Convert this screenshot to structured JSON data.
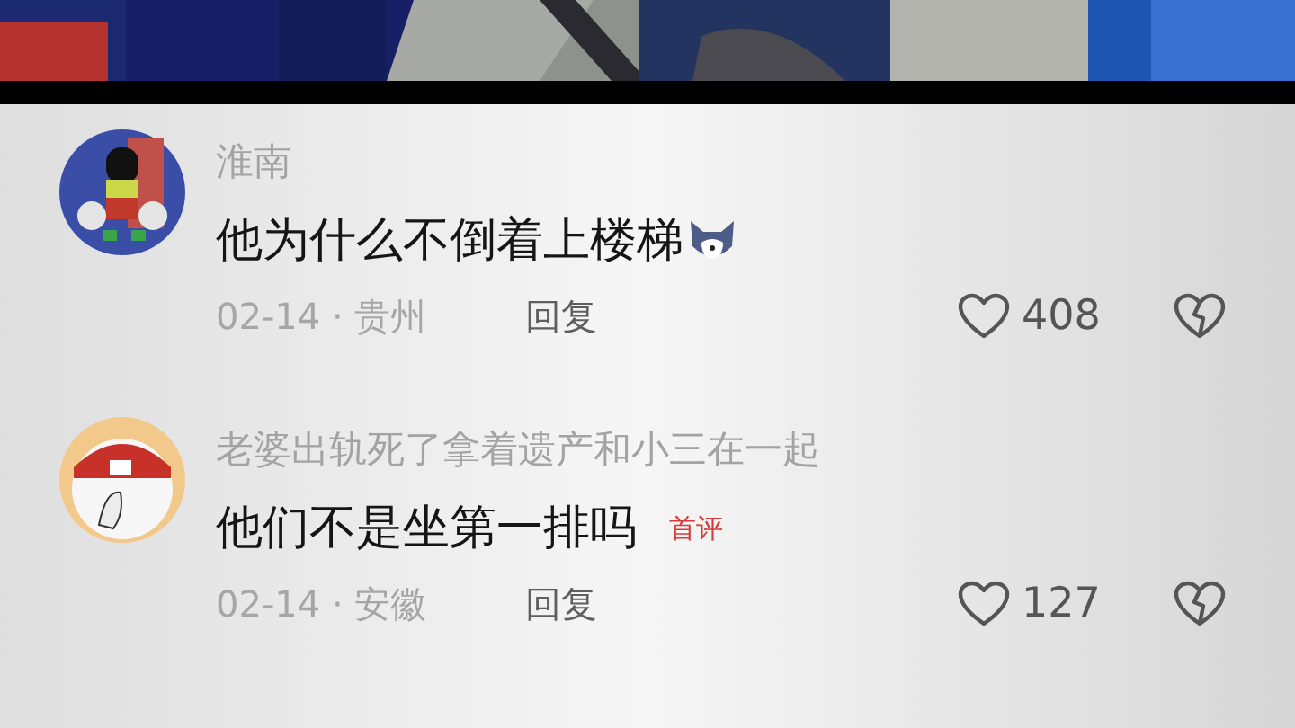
{
  "comments": [
    {
      "username": "淮南",
      "text": "他为什么不倒着上楼梯",
      "has_emoji": true,
      "date": "02-14 · 贵州",
      "reply": "回复",
      "likes": "408"
    },
    {
      "username": "老婆出轨死了拿着遗产和小三在一起",
      "text": "他们不是坐第一排吗",
      "badge": "首评",
      "has_emoji": false,
      "date": "02-14 · 安徽",
      "reply": "回复",
      "likes": "127"
    }
  ]
}
